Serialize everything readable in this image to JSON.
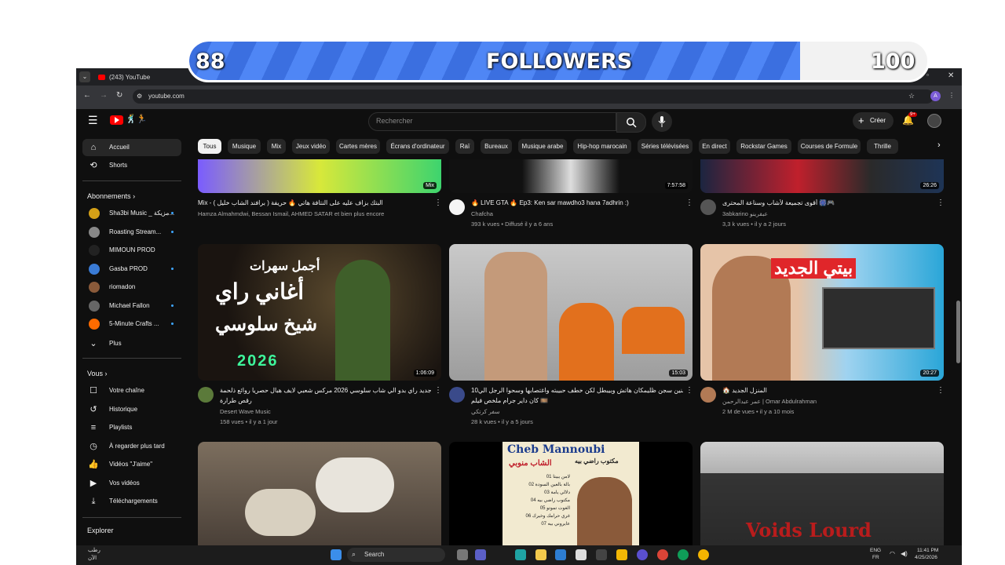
{
  "overlay": {
    "left_count": "88",
    "label": "FOLLOWERS",
    "right_count": "100",
    "progress": 0.88
  },
  "browser": {
    "tab_title": "(243) YouTube",
    "url": "youtube.com",
    "profile": "A"
  },
  "yt": {
    "search_placeholder": "Rechercher",
    "create_label": "Créer",
    "notif_badge": "9+",
    "chips": [
      "Tous",
      "Musique",
      "Mix",
      "Jeux vidéo",
      "Cartes mères",
      "Écrans d'ordinateur",
      "Raï",
      "Bureaux",
      "Musique arabe",
      "Hip-hop marocain",
      "Séries télévisées",
      "En direct",
      "Rockstar Games",
      "Courses de Formule",
      "Thrille"
    ]
  },
  "sidebar": {
    "home": "Accueil",
    "shorts": "Shorts",
    "subs_title": "Abonnements",
    "subs": [
      "Sha3bi Music _ مزيكة...",
      "Roasting Stream...",
      "MIMOUN PROD",
      "Gasba PROD",
      "riomadon",
      "Michael Fallon",
      "5-Minute Crafts ..."
    ],
    "more": "Plus",
    "you_title": "Vous",
    "you_items": [
      "Votre chaîne",
      "Historique",
      "Playlists",
      "À regarder plus tard",
      "Vidéos \"J'aime\"",
      "Vos vidéos",
      "Téléchargements"
    ],
    "explore_title": "Explorer"
  },
  "row1": [
    {
      "badge": "Mix",
      "title": "Mix - البتك بزاف عليه على النتافة هاتي 🔥 حريفة ( برافند الشاب خليل )",
      "channel": "Hamza Almahmdwi, Bessan Ismail, AHMED SATAR et bien plus encore",
      "meta": ""
    },
    {
      "duration": "7:57:58",
      "title": "🔥 LIVE GTA 🔥 Ep3: Ken sar mawdho3 hana 7adhrin :)",
      "channel": "Chafcha",
      "meta": "393 k vues • Diffusé il y a 6 ans"
    },
    {
      "duration": "26:26",
      "title": "أقوى تجميعة لأشاب وسناعة المحترى 🎆🎮",
      "channel": "3abkarino عبقرينو",
      "meta": "3,3 k vues • il y a 2 jours"
    }
  ],
  "row2": [
    {
      "duration": "1:06:09",
      "thumb_line1": "أجمل سهرات",
      "thumb_line2": "أغاني راي",
      "thumb_line3": "شيخ سلوسي",
      "thumb_year": "2026",
      "title": "جديد راي بدو الي شاب سلوسي 2026 مركس شعبي لايف هبال حصريا روائع ذلحمة",
      "title2": "رقص طرارة",
      "channel": "Desert Wave Music",
      "meta": "158 vues • il y a 1 jour"
    },
    {
      "duration": "15:03",
      "title": "10سنين سجن ظليمكان هاتش وبيبطل لكن خطف حبيبته واغتصابها وسحوا الرجل الي",
      "title2": "كان داير جرام ملخص فيلم 🎞️",
      "channel": "سفر كرتكي",
      "meta": "28 k vues • il y a 5 jours"
    },
    {
      "duration": "20:27",
      "thumb_text": "بيتي الجديد",
      "title": "🏠 المنزل الجديد",
      "channel": "عمر عبدالرحمن | Omar Abdulrahman",
      "meta": "2 M de vues • il y a 10 mois"
    }
  ],
  "row3": [
    {
      "thumb_title": ""
    },
    {
      "thumb_title": "Cheb Mannoubi",
      "thumb_sub": "مكتوب راضي بيه",
      "thumb_arabic": "الشاب منوبي",
      "songs": [
        "لامن يبيتا 01",
        "بالة بالعين السودة 02",
        "دلالي يامة 03",
        "مكتوب راضي بيه 04",
        "الغوت تموتو 05",
        "غري حرامك وخيرك 06",
        "عايروني بيه 07"
      ]
    },
    {
      "thumb_title": "Voids Lourd"
    }
  ],
  "taskbar": {
    "search": "Search",
    "lang": "ENG",
    "lang2": "FR",
    "time": "11:41 PM",
    "date": "4/25/2026",
    "weather": "رطب",
    "weather2": "الآن"
  },
  "colors": {
    "accent": "#3ea6ff",
    "red": "#ff0000",
    "bar_fill": "#4f86f5"
  }
}
